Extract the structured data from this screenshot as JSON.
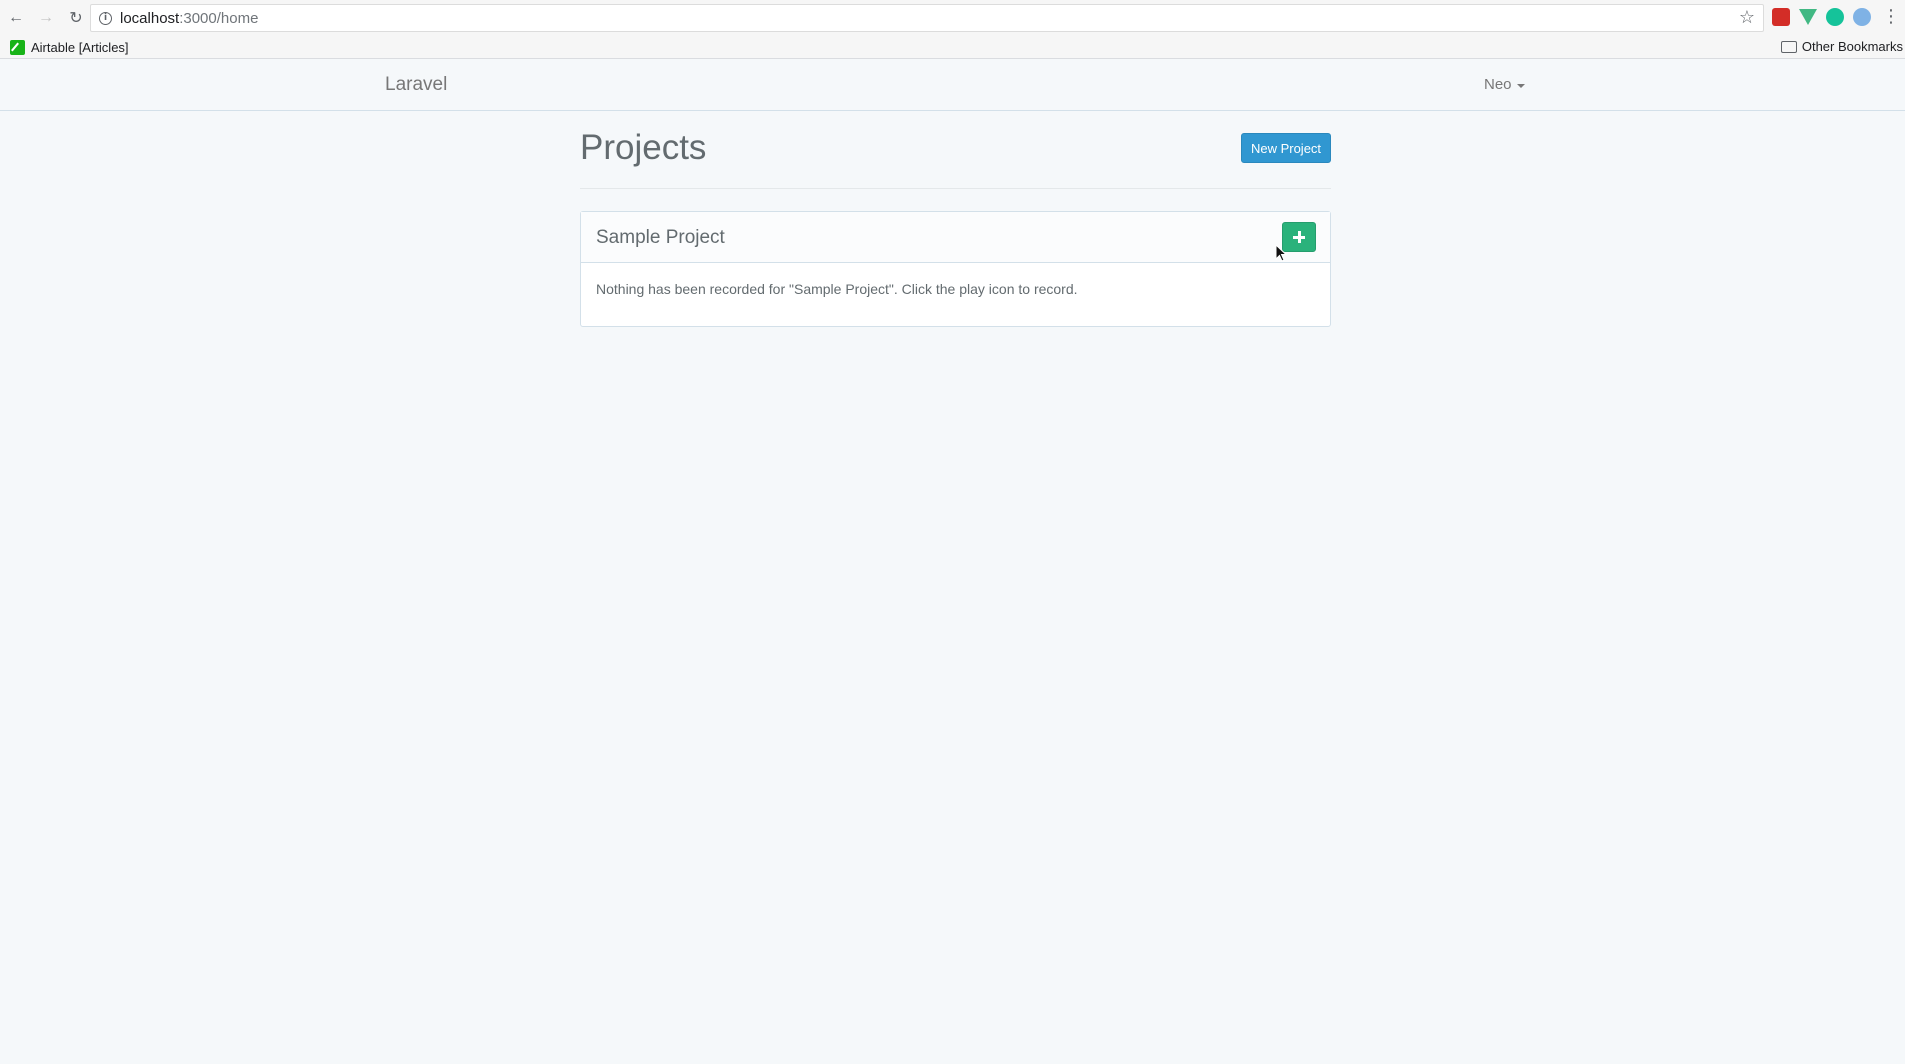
{
  "browser": {
    "url_host": "localhost",
    "url_path": ":3000/home",
    "back_glyph": "←",
    "forward_glyph": "→",
    "reload_glyph": "↻",
    "info_glyph": "i",
    "star_glyph": "☆",
    "menu_glyph": "⋮",
    "extension_icons": [
      "lastpass-icon",
      "vue-devtools-icon",
      "grammarly-icon",
      "globe-extension-icon"
    ]
  },
  "bookmarks": {
    "items": [
      {
        "label": "Airtable [Articles]",
        "icon": "airtable-icon"
      }
    ],
    "other_label": "Other Bookmarks"
  },
  "navbar": {
    "brand": "Laravel",
    "user_name": "Neo"
  },
  "main": {
    "title": "Projects",
    "new_project_label": "New Project"
  },
  "projects": [
    {
      "name": "Sample Project",
      "message": "Nothing has been recorded for \"Sample Project\". Click the play icon to record."
    }
  ],
  "colors": {
    "primary": "#3097d1",
    "success": "#2ab27b",
    "background": "#f5f8fa",
    "text": "#636b6f"
  }
}
